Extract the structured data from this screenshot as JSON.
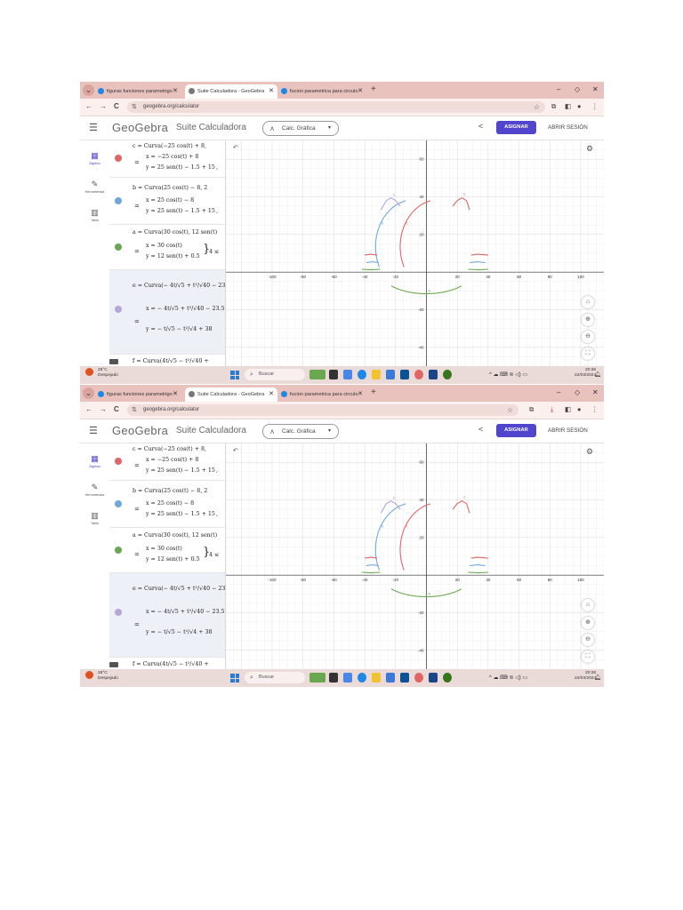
{
  "browser": {
    "tabs": [
      {
        "label": "figuras funciones parametrigo",
        "favicon_color": "#1e88e5"
      },
      {
        "label": "Suite Calculadora - GeoGebra",
        "favicon_color": "#777777"
      },
      {
        "label": "fucion parametrica para circulo",
        "favicon_color": "#1e88e5"
      }
    ],
    "new_tab": "+",
    "window_controls": {
      "minimize": "–",
      "maximize": "◇",
      "close": "✕"
    },
    "url": "geogebra.org/calculator"
  },
  "geogebra": {
    "logo": "GeoGebra",
    "suite_title": "Suite Calculadora",
    "app_select": "Calc. Gráfica",
    "assign_button": "ASIGNAR",
    "signin_button": "ABRIR SESIÓN",
    "sidebar": [
      {
        "label": "Álgebra",
        "icon": "calculator-icon"
      },
      {
        "label": "Herramientas",
        "icon": "tools-icon"
      },
      {
        "label": "Tabla",
        "icon": "table-icon"
      }
    ]
  },
  "algebra": {
    "rows": [
      {
        "color": "#e06666",
        "def": "c = Curva(−25 cos(t) + 8,",
        "lines": [
          "x = −25 cos(t) + 8",
          "y = 25 sen(t) − 1.5 + 15"
        ],
        "tail": ","
      },
      {
        "color": "#6fa8dc",
        "def": "b = Curva(25 cos(t) − 8, 2",
        "lines": [
          "x = 25 cos(t) − 8",
          "y = 25 sen(t) − 1.5 + 15"
        ],
        "tail": ","
      },
      {
        "color": "#6aa84f",
        "def": "a = Curva(30 cos(t), 12 sen(t)",
        "lines": [
          "x = 30 cos(t)",
          "y = 12 sen(t) + 0.5"
        ],
        "tail": "4 ≤"
      },
      {
        "color": "#b4a7d6",
        "def": "e = Curva(− 4t/√5 + t²/√40 − 23",
        "lines": [
          "x = − 4t/√5 + t²/√40 − 23.5",
          "y = − t/√5 − t²/√4 + 38"
        ],
        "tail": ""
      },
      {
        "color": "#b4a7d6",
        "def": "f = Curva(4t/√5 − t²/√40 +",
        "lines": [],
        "tail": ""
      }
    ]
  },
  "chart_data": {
    "type": "line",
    "title": "",
    "xlabel": "",
    "ylabel": "",
    "xlim": [
      -130,
      115
    ],
    "ylim": [
      -50,
      70
    ],
    "x_ticks": [
      -100,
      -80,
      -60,
      -40,
      -20,
      20,
      40,
      60,
      80,
      100
    ],
    "y_ticks": [
      60,
      40,
      20,
      -20,
      -40
    ],
    "grid": true,
    "series": [
      {
        "label": "c",
        "color": "#e06666",
        "kind": "param",
        "fx": "-25*cos(t)+8",
        "fy": "25*sin(t)+13.5",
        "t": [
          -0.45,
          1.35
        ]
      },
      {
        "label": "b",
        "color": "#6fa8dc",
        "kind": "param",
        "fx": "25*cos(t)-8",
        "fy": "25*sin(t)+13.5",
        "t": [
          1.79,
          3.59
        ]
      },
      {
        "label": "a",
        "color": "#6aa84f",
        "kind": "param",
        "fx": "30*cos(t)",
        "fy": "12*sin(t)+0.5",
        "t": [
          3.85,
          5.57
        ]
      },
      {
        "label": "e",
        "color": "#b4a7d6",
        "kind": "poly",
        "points": [
          [
            -29.5,
            33
          ],
          [
            -26,
            38
          ],
          [
            -23,
            39.5
          ],
          [
            -20,
            38
          ],
          [
            -17,
            35
          ]
        ]
      },
      {
        "label": "f",
        "color": "#e06666",
        "kind": "poly",
        "points": [
          [
            17,
            35
          ],
          [
            20,
            38
          ],
          [
            23,
            39.5
          ],
          [
            26,
            38
          ],
          [
            28,
            33
          ]
        ]
      },
      {
        "label": "",
        "color": "#e06666",
        "kind": "poly",
        "points": [
          [
            -40,
            9
          ],
          [
            -36,
            9.5
          ],
          [
            -32,
            9
          ]
        ]
      },
      {
        "label": "",
        "color": "#6fa8dc",
        "kind": "poly",
        "points": [
          [
            -39,
            5
          ],
          [
            -35,
            5.5
          ],
          [
            -31,
            5
          ]
        ]
      },
      {
        "label": "",
        "color": "#6aa84f",
        "kind": "poly",
        "points": [
          [
            -42,
            1.5
          ],
          [
            -36,
            1.2
          ],
          [
            -30,
            1.5
          ]
        ]
      },
      {
        "label": "",
        "color": "#e06666",
        "kind": "poly",
        "points": [
          [
            29,
            9
          ],
          [
            33,
            9.5
          ],
          [
            40,
            9
          ]
        ]
      },
      {
        "label": "",
        "color": "#6fa8dc",
        "kind": "poly",
        "points": [
          [
            28,
            5
          ],
          [
            33,
            5.5
          ],
          [
            38,
            5
          ]
        ]
      },
      {
        "label": "",
        "color": "#6aa84f",
        "kind": "poly",
        "points": [
          [
            27,
            1.5
          ],
          [
            34,
            1.2
          ],
          [
            40,
            1.5
          ]
        ]
      }
    ]
  },
  "taskbar": {
    "temperature": "28°C",
    "weather": "Despejado",
    "search": "Buscar",
    "time": "20:38",
    "date": "22/03/2024",
    "tray": "^  ☁  ⌨  ≋  ◁)  ▭"
  }
}
